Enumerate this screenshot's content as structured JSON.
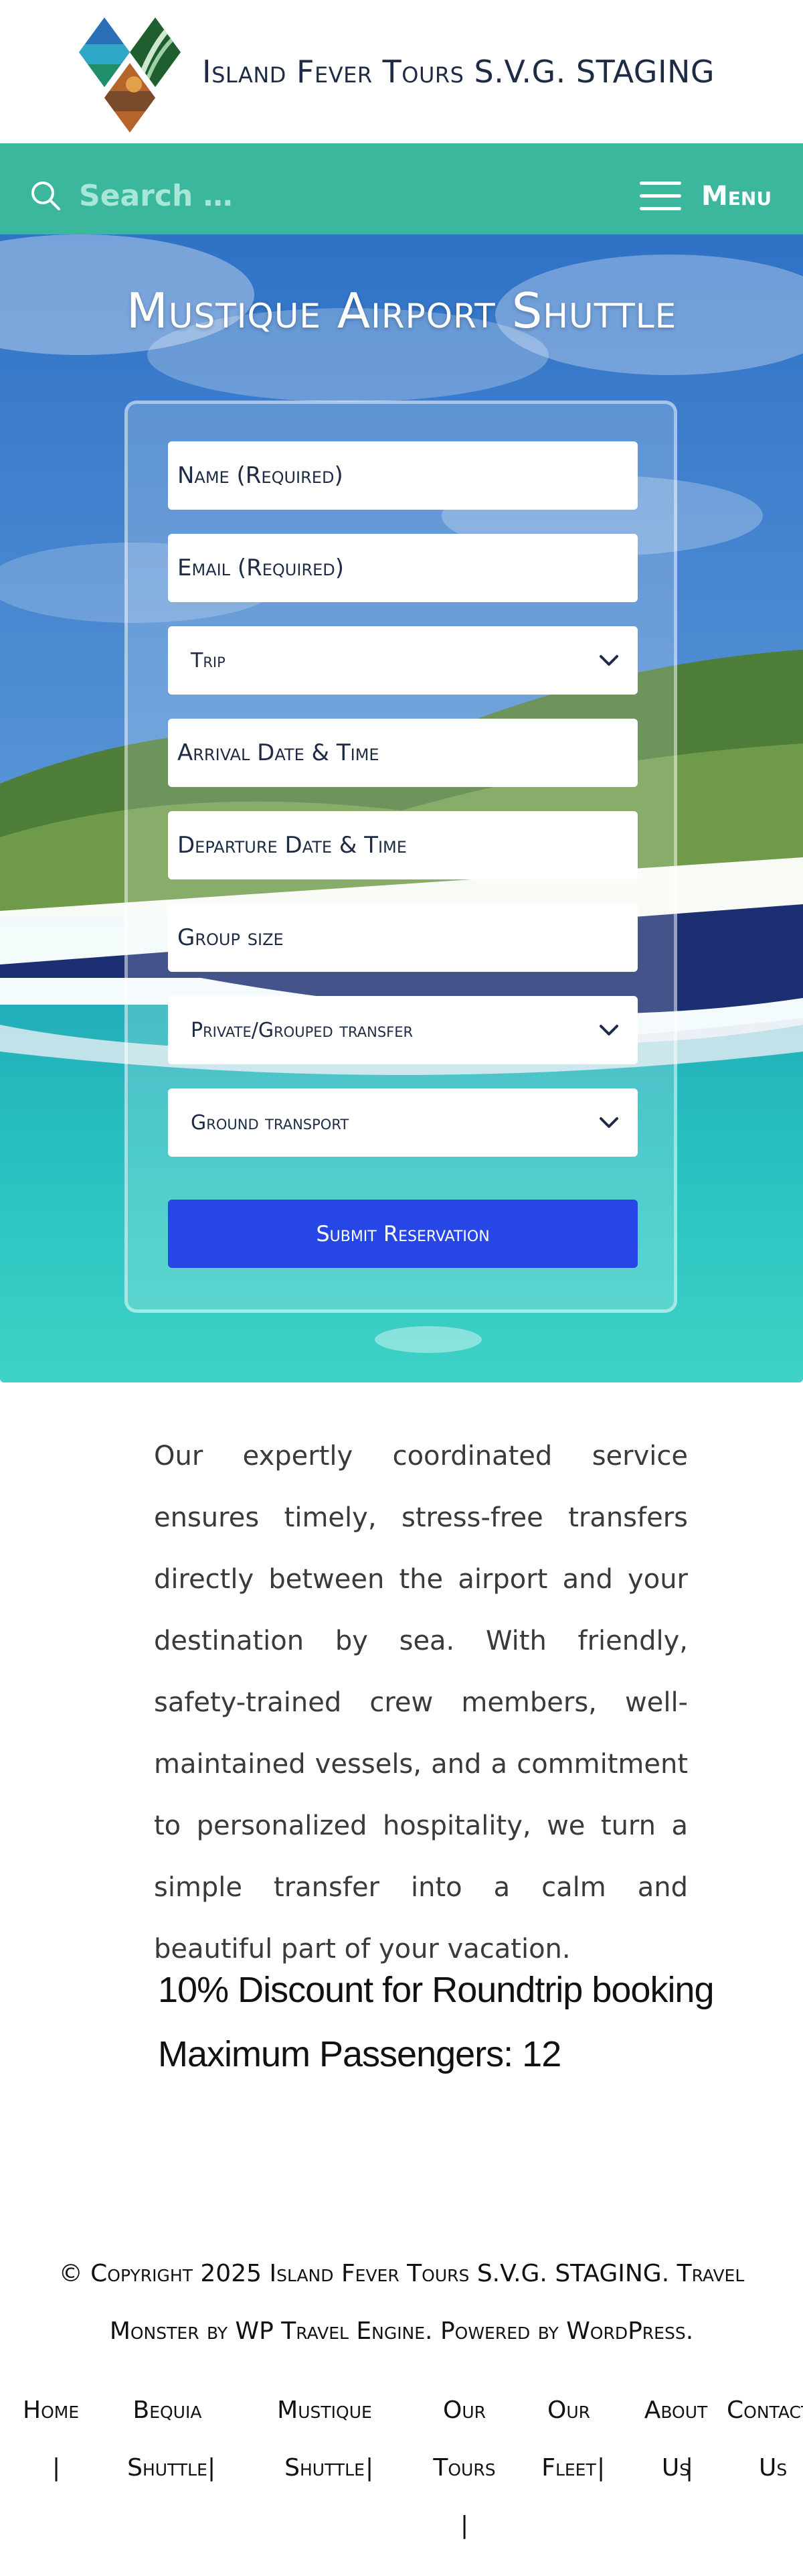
{
  "header": {
    "site_title": "Island Fever Tours S.V.G. STAGING"
  },
  "nav": {
    "search_placeholder": "Search …",
    "menu_label": "Menu",
    "accent_color": "#3ab79c"
  },
  "hero": {
    "title": "Mustique Airport Shuttle",
    "form": {
      "name_placeholder": "Name (Required)",
      "email_placeholder": "Email (Required)",
      "trip_label": "Trip",
      "arrival_placeholder": "Arrival Date & Time",
      "departure_placeholder": "Departure Date & Time",
      "group_size_placeholder": "Group size",
      "transfer_label": "Private/Grouped transfer",
      "ground_transport_label": "Ground transport",
      "submit_label": "Submit Reservation",
      "submit_color": "#2647e6"
    }
  },
  "content": {
    "intro": "Our expertly coordinated service ensures timely, stress-free transfers directly between the airport and your destination by sea. With friendly, safety-trained crew members, well-maintained vessels, and a commitment to personalized hospitality, we turn a simple transfer into a calm and beautiful part of your vacation.",
    "discount": "10% Discount for Roundtrip booking",
    "max_passengers": "Maximum Passengers: 12"
  },
  "footer": {
    "copyright_line1": "© Copyright 2025 Island Fever Tours S.V.G. STAGING. Travel",
    "copyright_line2": "Monster by WP Travel Engine. Powered by WordPress.",
    "nav": {
      "home": "Home",
      "bequia_line1": "Bequia",
      "bequia_line2": "Shuttle",
      "mustique_line1": "Mustique",
      "mustique_line2": "Shuttle",
      "tours_line1": "Our",
      "tours_line2": "Tours",
      "fleet_line1": "Our",
      "fleet_line2": "Fleet",
      "about_line1": "About",
      "about_line2": "Us",
      "contact_line1": "Contact",
      "contact_line2": "Us",
      "separator": "|"
    }
  }
}
